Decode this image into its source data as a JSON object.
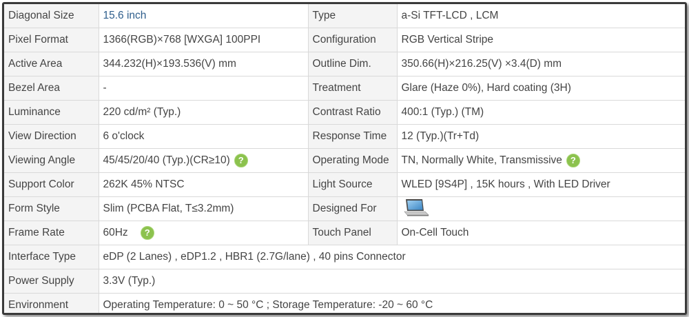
{
  "rows": [
    {
      "l1": "Diagonal Size",
      "v1": "15.6 inch",
      "l2": "Type",
      "v2": "a-Si TFT-LCD , LCM"
    },
    {
      "l1": "Pixel Format",
      "v1": "1366(RGB)×768  [WXGA]  100PPI",
      "l2": "Configuration",
      "v2": "RGB Vertical Stripe"
    },
    {
      "l1": "Active Area",
      "v1": "344.232(H)×193.536(V) mm",
      "l2": "Outline Dim.",
      "v2": "350.66(H)×216.25(V) ×3.4(D) mm"
    },
    {
      "l1": "Bezel Area",
      "v1": "-",
      "l2": "Treatment",
      "v2": "Glare (Haze 0%), Hard coating (3H)"
    },
    {
      "l1": "Luminance",
      "v1": "220 cd/m² (Typ.)",
      "l2": "Contrast Ratio",
      "v2": "400:1 (Typ.) (TM)"
    },
    {
      "l1": "View Direction",
      "v1": "6 o'clock",
      "l2": "Response Time",
      "v2": "12 (Typ.)(Tr+Td)"
    },
    {
      "l1": "Viewing Angle",
      "v1": "45/45/20/40 (Typ.)(CR≥10)",
      "l2": "Operating Mode",
      "v2": "TN, Normally White, Transmissive"
    },
    {
      "l1": "Support Color",
      "v1": "262K   45% NTSC",
      "l2": "Light Source",
      "v2": "WLED  [9S4P] , 15K hours , With LED Driver"
    },
    {
      "l1": "Form Style",
      "v1": "Slim (PCBA Flat, T≤3.2mm)",
      "l2": "Designed For",
      "v2": ""
    },
    {
      "l1": "Frame Rate",
      "v1": "60Hz",
      "l2": "Touch Panel",
      "v2": "On-Cell Touch"
    }
  ],
  "wide_rows": [
    {
      "label": "Interface Type",
      "value": "eDP (2 Lanes) , eDP1.2 , HBR1 (2.7G/lane) , 40 pins Connector"
    },
    {
      "label": "Power Supply",
      "value": "3.3V (Typ.)"
    },
    {
      "label": "Environment",
      "value": "Operating Temperature: 0 ~ 50 °C ; Storage Temperature: -20 ~ 60 °C"
    }
  ],
  "help_glyph": "?",
  "colors": {
    "accent": "#2e5e8c",
    "help": "#8cc24e",
    "label_bg": "#f4f4f4",
    "border": "#d9d9d9"
  },
  "icons": {
    "help": "question-circle-icon",
    "designed_for": "laptop-icon"
  }
}
